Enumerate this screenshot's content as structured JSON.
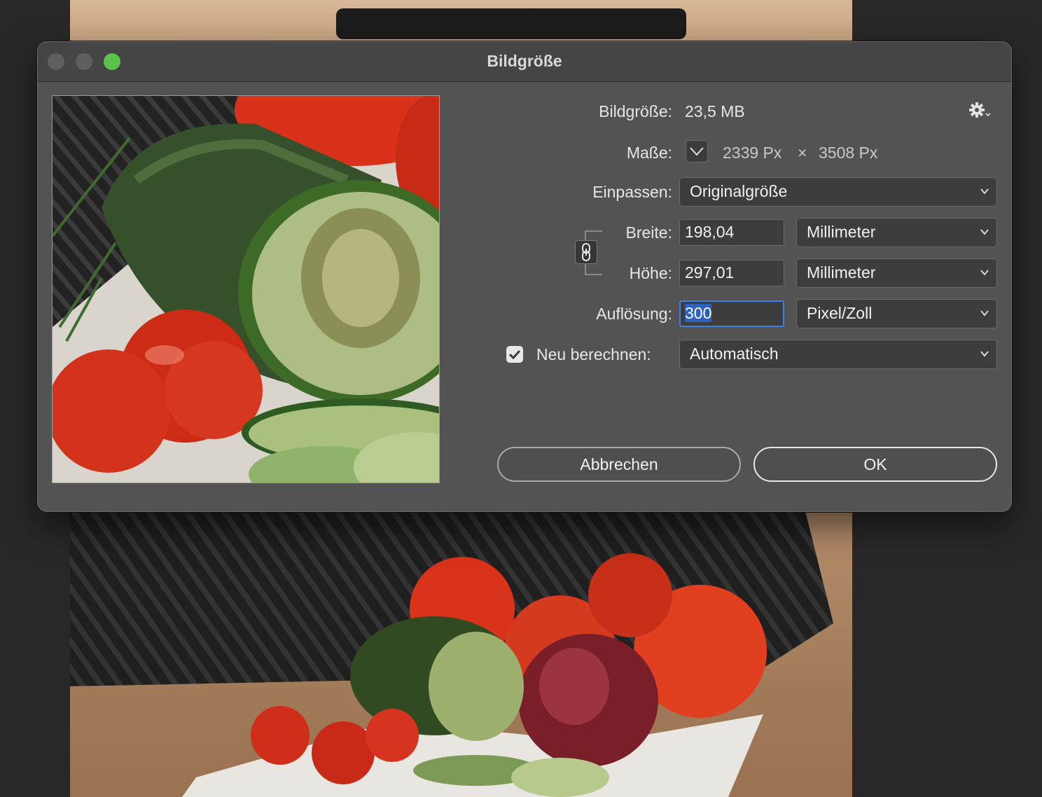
{
  "dialog": {
    "title": "Bildgröße",
    "image_size_label": "Bildgröße:",
    "image_size_value": "23,5 MB",
    "dimensions_label": "Maße:",
    "width_px": "2339 Px",
    "times": "×",
    "height_px": "3508 Px",
    "fit_label": "Einpassen:",
    "fit_value": "Originalgröße",
    "width_label": "Breite:",
    "width_value": "198,04",
    "width_unit": "Millimeter",
    "height_label": "Höhe:",
    "height_value": "297,01",
    "height_unit": "Millimeter",
    "resolution_label": "Auflösung:",
    "resolution_value": "300",
    "resolution_unit": "Pixel/Zoll",
    "resample_label": "Neu berechnen:",
    "resample_checked": true,
    "resample_value": "Automatisch",
    "cancel_label": "Abbrechen",
    "ok_label": "OK"
  },
  "icons": {
    "gear": "gear-icon",
    "chain": "link-chain-icon",
    "chevron": "chevron-down-icon",
    "check": "checkmark-icon"
  },
  "colors": {
    "dialog_bg": "#535353",
    "titlebar_bg": "#454545",
    "focus_ring": "#3d82e6",
    "traffic_green": "#5ac24a"
  }
}
